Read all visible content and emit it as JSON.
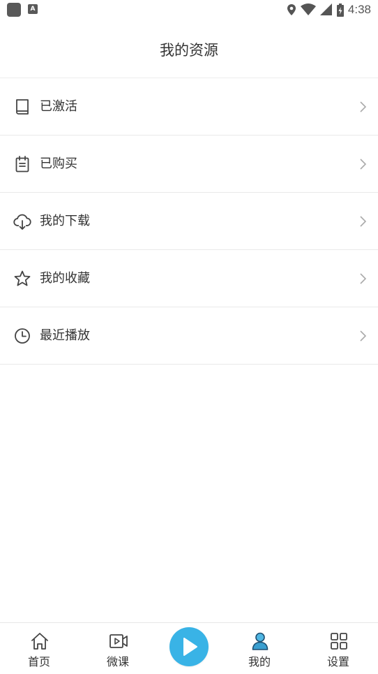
{
  "status_bar": {
    "time": "4:38",
    "left_icons": [
      "app-notification-icon",
      "keyboard-a-icon"
    ],
    "right_icons": [
      "location-icon",
      "wifi-icon",
      "signal-icon",
      "battery-charging-icon"
    ]
  },
  "header": {
    "title": "我的资源"
  },
  "list": {
    "items": [
      {
        "label": "已激活",
        "icon": "book-icon"
      },
      {
        "label": "已购买",
        "icon": "clipboard-icon"
      },
      {
        "label": "我的下载",
        "icon": "cloud-download-icon"
      },
      {
        "label": "我的收藏",
        "icon": "star-icon"
      },
      {
        "label": "最近播放",
        "icon": "clock-icon"
      }
    ]
  },
  "tab_bar": {
    "tabs": [
      {
        "label": "首页",
        "icon": "home-icon",
        "active": false
      },
      {
        "label": "微课",
        "icon": "video-icon",
        "active": false
      },
      {
        "label": "我的",
        "icon": "user-icon",
        "active": true
      },
      {
        "label": "设置",
        "icon": "grid-icon",
        "active": false
      }
    ],
    "center_button_icon": "play-icon"
  },
  "colors": {
    "accent": "#39b3e6",
    "user_icon_active": "#2e8fbf",
    "text": "#333333",
    "divider": "#e9e9e9",
    "chevron": "#aaaaaa",
    "icon_stroke": "#444444"
  }
}
